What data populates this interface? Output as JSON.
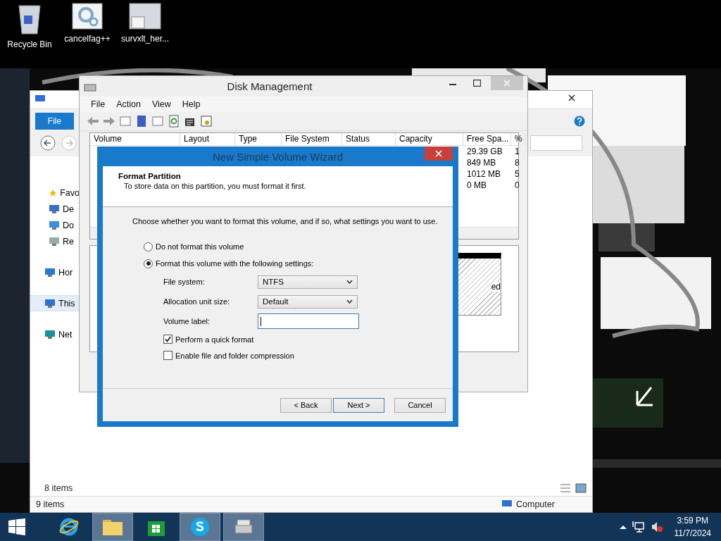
{
  "desktop": {
    "icons": [
      {
        "label": "Recycle Bin",
        "kind": "bin"
      },
      {
        "label": "cancelfag++",
        "kind": "app"
      },
      {
        "label": "survxlt_her...",
        "kind": "file"
      }
    ]
  },
  "explorer": {
    "file_tab": "File",
    "sidebar": [
      {
        "label": "Favo",
        "kind": "star",
        "selected": false
      },
      {
        "label": "De",
        "kind": "desktop",
        "selected": false
      },
      {
        "label": "Do",
        "kind": "downloads",
        "selected": false
      },
      {
        "label": "Re",
        "kind": "recent",
        "selected": false
      },
      {
        "label": "Hor",
        "kind": "homegroup",
        "selected": false
      },
      {
        "label": "This",
        "kind": "pc",
        "selected": true
      },
      {
        "label": "Net",
        "kind": "network",
        "selected": false
      }
    ],
    "item_count": "8 items",
    "status": "9 items",
    "location": "Computer"
  },
  "disk_management": {
    "title": "Disk Management",
    "menu": [
      "File",
      "Action",
      "View",
      "Help"
    ],
    "columns": [
      "Volume",
      "Layout",
      "Type",
      "File System",
      "Status",
      "Capacity",
      "Free Spa...",
      "%"
    ],
    "rows": [
      {
        "free_space": "29.39 GB",
        "percent": "1"
      },
      {
        "free_space": "849 MB",
        "percent": "8"
      },
      {
        "free_space": "1012 MB",
        "percent": "5"
      },
      {
        "free_space": "0 MB",
        "percent": "0"
      }
    ],
    "partition_fragment": "ed"
  },
  "wizard": {
    "title": "New Simple Volume Wizard",
    "heading": "Format Partition",
    "subheading": "To store data on this partition, you must format it first.",
    "instruction": "Choose whether you want to format this volume, and if so, what settings you want to use.",
    "options": [
      {
        "label": "Do not format this volume",
        "selected": false
      },
      {
        "label": "Format this volume with the following settings:",
        "selected": true
      }
    ],
    "fields": [
      {
        "label": "File system:",
        "kind": "select",
        "value": "NTFS"
      },
      {
        "label": "Allocation unit size:",
        "kind": "select",
        "value": "Default"
      },
      {
        "label": "Volume label:",
        "kind": "text",
        "focused": true
      }
    ],
    "checkboxes": [
      {
        "label": "Perform a quick format",
        "checked": true
      },
      {
        "label": "Enable file and folder compression",
        "checked": false
      }
    ],
    "buttons": [
      {
        "label": "< Back",
        "default": false
      },
      {
        "label": "Next >",
        "default": true
      },
      {
        "label": "Cancel",
        "default": false
      }
    ]
  },
  "taskbar": {
    "apps": [
      {
        "kind": "ie",
        "active": false
      },
      {
        "kind": "folder",
        "active": true
      },
      {
        "kind": "store",
        "active": false
      },
      {
        "kind": "skype",
        "active": true
      },
      {
        "kind": "disk",
        "active": true
      }
    ],
    "time": "3:59 PM",
    "date": "11/7/2024"
  }
}
